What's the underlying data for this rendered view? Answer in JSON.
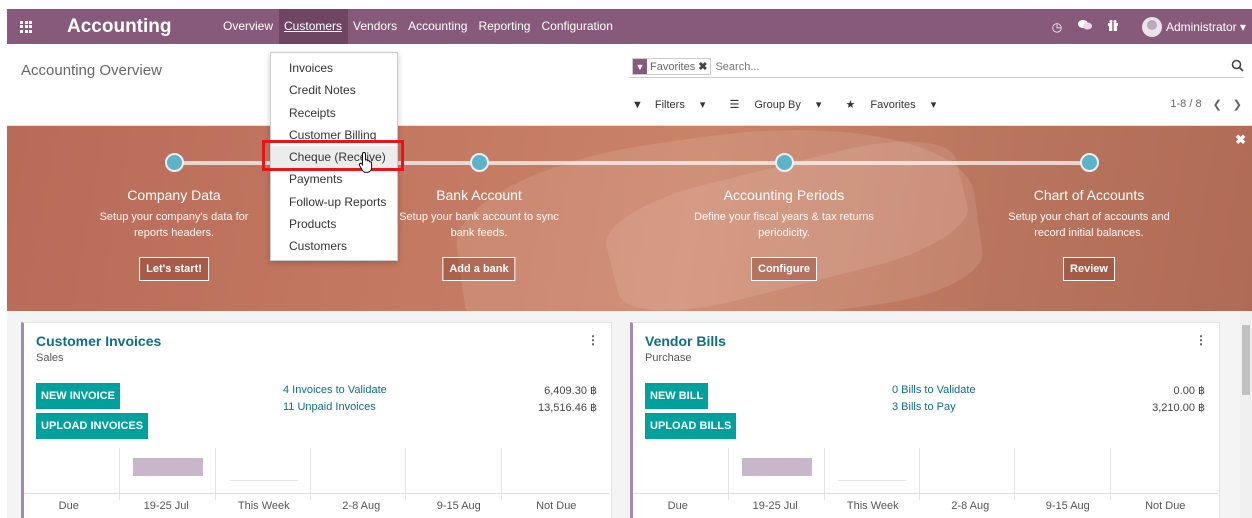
{
  "navbar": {
    "app_title": "Accounting",
    "menu": [
      "Overview",
      "Customers",
      "Vendors",
      "Accounting",
      "Reporting",
      "Configuration"
    ],
    "active_menu": "Customers",
    "user": "Administrator",
    "accent_color": "#875a7b"
  },
  "control_panel": {
    "breadcrumb": "Accounting Overview",
    "facet": "Favorites",
    "search_placeholder": "Search...",
    "filters_label": "Filters",
    "groupby_label": "Group By",
    "favorites_label": "Favorites",
    "pager": "1-8 / 8"
  },
  "customers_menu": {
    "items": [
      "Invoices",
      "Credit Notes",
      "Receipts",
      "Customer Billing",
      "Cheque (Receive)",
      "Payments",
      "Follow-up Reports",
      "Products",
      "Customers"
    ],
    "highlighted": "Cheque (Receive)"
  },
  "onboarding": {
    "steps": [
      {
        "title": "Company Data",
        "desc": "Setup your company's data for reports headers.",
        "button": "Let's start!"
      },
      {
        "title": "Bank Account",
        "desc": "Setup your bank account to sync bank feeds.",
        "button": "Add a bank"
      },
      {
        "title": "Accounting Periods",
        "desc": "Define your fiscal years & tax returns periodicity.",
        "button": "Configure"
      },
      {
        "title": "Chart of Accounts",
        "desc": "Setup your chart of accounts and record initial balances.",
        "button": "Review"
      }
    ]
  },
  "dashboard": {
    "cards": [
      {
        "title": "Customer Invoices",
        "subtitle": "Sales",
        "primary_button": "NEW INVOICE",
        "secondary_button": "UPLOAD INVOICES",
        "link1": "4 Invoices to Validate",
        "value1": "6,409.30 ฿",
        "link2": "11 Unpaid Invoices",
        "value2": "13,516.46 ฿",
        "chart_labels": [
          "Due",
          "19-25 Jul",
          "This Week",
          "2-8 Aug",
          "9-15 Aug",
          "Not Due"
        ],
        "chart_values": [
          0,
          6409.3,
          0,
          0,
          0,
          0
        ]
      },
      {
        "title": "Vendor Bills",
        "subtitle": "Purchase",
        "primary_button": "NEW BILL",
        "secondary_button": "UPLOAD BILLS",
        "link1": "0 Bills to Validate",
        "value1": "0.00 ฿",
        "link2": "3 Bills to Pay",
        "value2": "3,210.00 ฿",
        "chart_labels": [
          "Due",
          "19-25 Jul",
          "This Week",
          "2-8 Aug",
          "9-15 Aug",
          "Not Due"
        ],
        "chart_values": [
          0,
          3210.0,
          0,
          0,
          0,
          0
        ]
      }
    ]
  }
}
